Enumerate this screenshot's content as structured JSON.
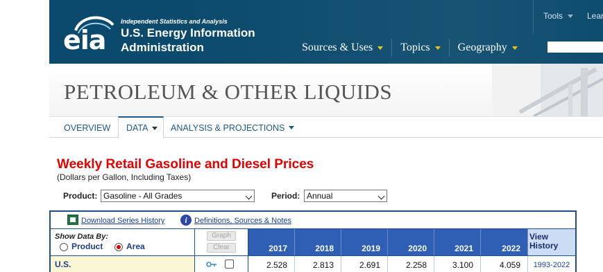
{
  "header": {
    "logo": "eia",
    "tagline": "Independent Statistics and Analysis",
    "org_line1": "U.S. Energy Information",
    "org_line2": "Administration",
    "nav": [
      {
        "label": "Sources & Uses"
      },
      {
        "label": "Topics"
      },
      {
        "label": "Geography"
      }
    ],
    "tools": [
      {
        "label": "Tools"
      },
      {
        "label": "Lear"
      }
    ]
  },
  "banner": {
    "title": "PETROLEUM & OTHER LIQUIDS"
  },
  "tabs": [
    {
      "label": "OVERVIEW"
    },
    {
      "label": "DATA"
    },
    {
      "label": "ANALYSIS & PROJECTIONS"
    }
  ],
  "page": {
    "title": "Weekly Retail Gasoline and Diesel Prices",
    "subtitle": "(Dollars per Gallon, Including Taxes)",
    "product_label": "Product:",
    "product_value": "Gasoline - All Grades",
    "period_label": "Period:",
    "period_value": "Annual"
  },
  "table": {
    "download_link": "Download Series History",
    "definitions_link": "Definitions, Sources & Notes",
    "show_by_label": "Show Data By:",
    "radio_product": "Product",
    "radio_area": "Area",
    "graph_button": "Graph",
    "clear_button": "Clear",
    "years": [
      "2017",
      "2018",
      "2019",
      "2020",
      "2021",
      "2022"
    ],
    "view_history_header": "View History",
    "rows": [
      {
        "label": "U.S.",
        "values": [
          "2.528",
          "2.813",
          "2.691",
          "2.258",
          "3.100",
          "4.059"
        ],
        "history": "1993-2022"
      }
    ]
  },
  "colors": {
    "header_bg": "#0b4a6c",
    "title_red": "#e30000",
    "year_header_bg": "#2f5fb5",
    "table_border": "#1f4e8c",
    "row_label_bg": "#fbf6d6"
  }
}
